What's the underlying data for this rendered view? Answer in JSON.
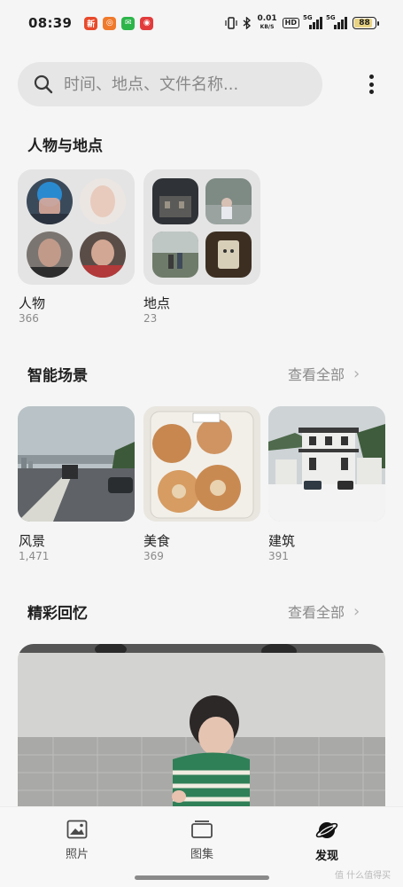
{
  "status_bar": {
    "time": "08:39",
    "notifications": [
      {
        "icon": "news-app-icon",
        "color": "#e84a2b",
        "glyph": "新"
      },
      {
        "icon": "weibo-app-icon",
        "color": "#f07a2b",
        "glyph": "◎"
      },
      {
        "icon": "wechat-app-icon",
        "color": "#2db54a",
        "glyph": "✉"
      },
      {
        "icon": "netease-music-icon",
        "color": "#e23b3b",
        "glyph": "◉"
      }
    ],
    "speed_value": "0.01",
    "speed_unit": "KB/S",
    "hd_label": "HD",
    "signal1_tag": "5G",
    "signal2_tag": "5G",
    "battery_percent": "88",
    "battery_level": 0.88
  },
  "search": {
    "placeholder": "时间、地点、文件名称..."
  },
  "people_places": {
    "title": "人物与地点",
    "people": {
      "label": "人物",
      "count": "366"
    },
    "places": {
      "label": "地点",
      "count": "23"
    }
  },
  "smart_scenes": {
    "title": "智能场景",
    "see_all": "查看全部",
    "items": [
      {
        "label": "风景",
        "count": "1,471"
      },
      {
        "label": "美食",
        "count": "369"
      },
      {
        "label": "建筑",
        "count": "391"
      }
    ]
  },
  "memories": {
    "title": "精彩回忆",
    "see_all": "查看全部"
  },
  "bottom_nav": {
    "items": [
      {
        "label": "照片",
        "icon": "photo-icon"
      },
      {
        "label": "图集",
        "icon": "album-icon"
      },
      {
        "label": "发现",
        "icon": "discover-planet-icon",
        "active": true
      }
    ]
  },
  "watermark": "值 什么值得买"
}
